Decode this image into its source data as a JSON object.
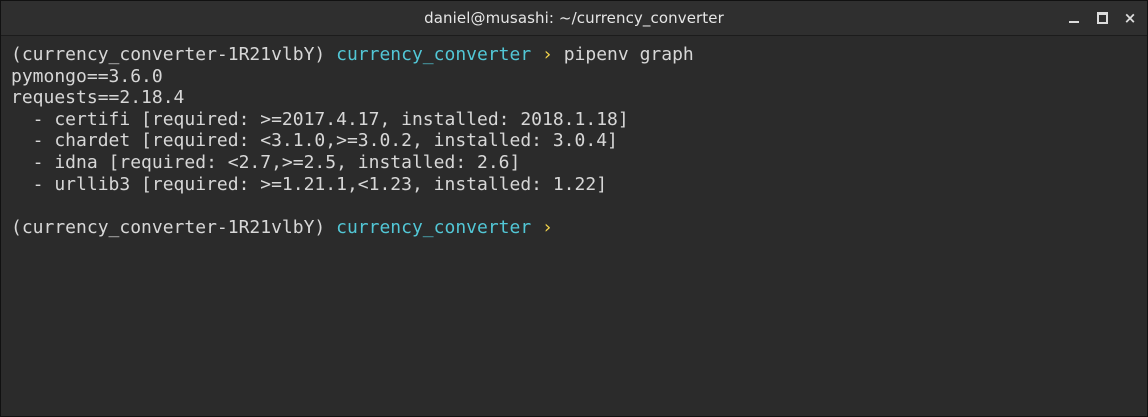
{
  "window": {
    "title": "daniel@musashi: ~/currency_converter",
    "controls": {
      "minimize": "minimize",
      "maximize": "maximize",
      "close": "×"
    }
  },
  "terminal": {
    "prompt1": {
      "env": "(currency_converter-1R21vlbY) ",
      "dir": "currency_converter",
      "arrow": "›",
      "command": " pipenv graph"
    },
    "output": [
      "pymongo==3.6.0",
      "requests==2.18.4",
      "  - certifi [required: >=2017.4.17, installed: 2018.1.18]",
      "  - chardet [required: <3.1.0,>=3.0.2, installed: 3.0.4]",
      "  - idna [required: <2.7,>=2.5, installed: 2.6]",
      "  - urllib3 [required: >=1.21.1,<1.23, installed: 1.22]",
      ""
    ],
    "prompt2": {
      "env": "(currency_converter-1R21vlbY) ",
      "dir": "currency_converter",
      "arrow": "›"
    }
  },
  "colors": {
    "background": "#2b2b2b",
    "text": "#d7d7d7",
    "directory": "#52c7d6",
    "prompt_arrow": "#f2d34b"
  }
}
